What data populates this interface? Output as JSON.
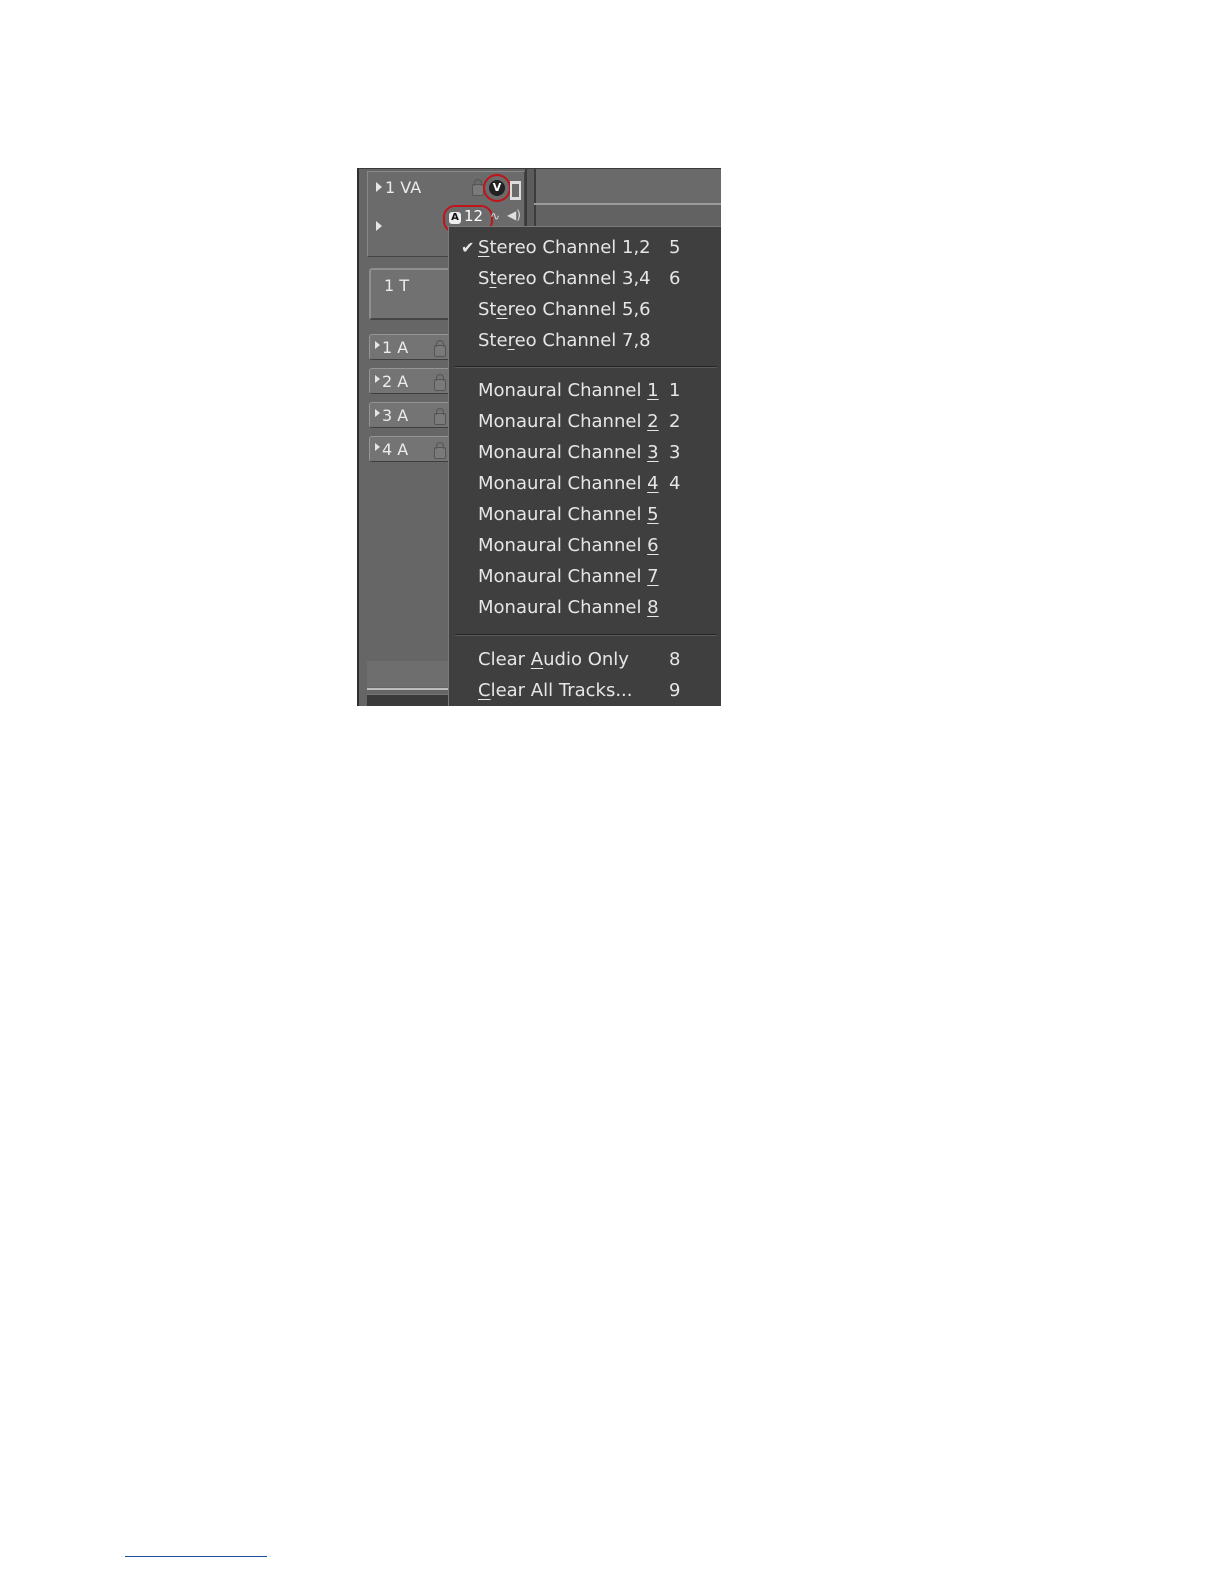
{
  "tracks": {
    "va_label": "1 VA",
    "a_patch_value": "12",
    "a_badge": "A",
    "v_badge": "V",
    "t_label": "1 T",
    "audio_tracks": [
      "1 A",
      "2 A",
      "3 A",
      "4 A"
    ]
  },
  "menu": {
    "stereo": [
      {
        "pre": "",
        "ul": "S",
        "post": "tereo Channel 1,2",
        "key": "5",
        "checked": true
      },
      {
        "pre": "S",
        "ul": "t",
        "post": "ereo Channel 3,4",
        "key": "6",
        "checked": false
      },
      {
        "pre": "St",
        "ul": "e",
        "post": "reo Channel 5,6",
        "key": "",
        "checked": false
      },
      {
        "pre": "Ste",
        "ul": "r",
        "post": "eo Channel 7,8",
        "key": "",
        "checked": false
      }
    ],
    "mono": [
      {
        "pre": "Monaural Channel ",
        "ul": "1",
        "post": "",
        "key": "1"
      },
      {
        "pre": "Monaural Channel ",
        "ul": "2",
        "post": "",
        "key": "2"
      },
      {
        "pre": "Monaural Channel ",
        "ul": "3",
        "post": "",
        "key": "3"
      },
      {
        "pre": "Monaural Channel ",
        "ul": "4",
        "post": "",
        "key": "4"
      },
      {
        "pre": "Monaural Channel ",
        "ul": "5",
        "post": "",
        "key": ""
      },
      {
        "pre": "Monaural Channel ",
        "ul": "6",
        "post": "",
        "key": ""
      },
      {
        "pre": "Monaural Channel ",
        "ul": "7",
        "post": "",
        "key": ""
      },
      {
        "pre": "Monaural Channel ",
        "ul": "8",
        "post": "",
        "key": ""
      }
    ],
    "clear": [
      {
        "pre": "Clear ",
        "ul": "A",
        "post": "udio Only",
        "key": "8"
      },
      {
        "pre": "",
        "ul": "C",
        "post": "lear All Tracks...",
        "key": "9"
      }
    ],
    "check_glyph": "✔"
  },
  "colors": {
    "menu_bg": "#3f3f3f",
    "menu_text": "#e6e6e6",
    "highlight_ring": "#c0131a"
  }
}
